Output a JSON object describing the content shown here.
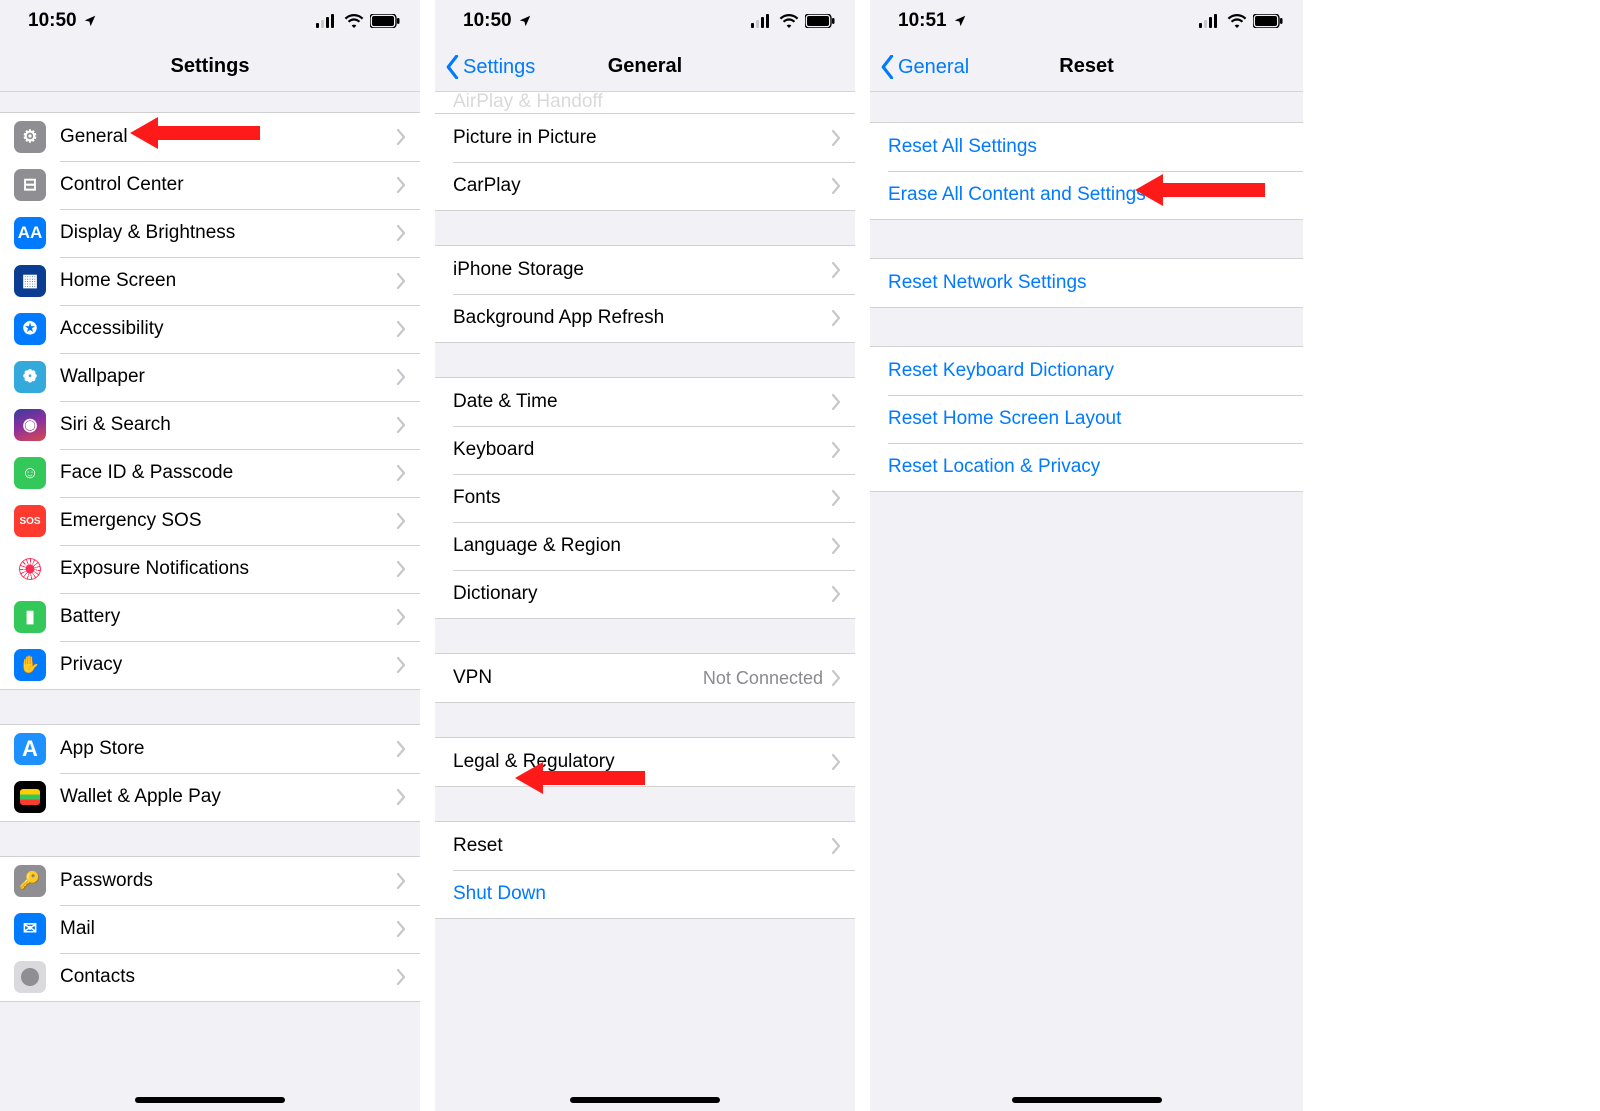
{
  "screens": {
    "settings": {
      "time": "10:50",
      "title": "Settings",
      "items_g1": [
        {
          "name": "general",
          "label": "General",
          "iconColor": "ic-gray",
          "glyph": "⚙"
        },
        {
          "name": "control-center",
          "label": "Control Center",
          "iconColor": "ic-gray",
          "glyph": "⊟"
        },
        {
          "name": "display-brightness",
          "label": "Display & Brightness",
          "iconColor": "ic-blue",
          "glyph": "AA"
        },
        {
          "name": "home-screen",
          "label": "Home Screen",
          "iconColor": "ic-darkblue",
          "glyph": "▦"
        },
        {
          "name": "accessibility",
          "label": "Accessibility",
          "iconColor": "ic-blue",
          "glyph": "✪"
        },
        {
          "name": "wallpaper",
          "label": "Wallpaper",
          "iconColor": "ic-teal",
          "glyph": "❁"
        },
        {
          "name": "siri-search",
          "label": "Siri & Search",
          "iconColor": "ic-indigo",
          "glyph": "◉"
        },
        {
          "name": "faceid-passcode",
          "label": "Face ID & Passcode",
          "iconColor": "ic-green",
          "glyph": "☺"
        },
        {
          "name": "emergency-sos",
          "label": "Emergency SOS",
          "iconColor": "ic-red",
          "glyph": "SOS"
        },
        {
          "name": "exposure-notifications",
          "label": "Exposure Notifications",
          "iconColor": "pink",
          "glyph": ""
        },
        {
          "name": "battery",
          "label": "Battery",
          "iconColor": "ic-green",
          "glyph": "▮"
        },
        {
          "name": "privacy",
          "label": "Privacy",
          "iconColor": "ic-blue",
          "glyph": "✋"
        }
      ],
      "items_g2": [
        {
          "name": "app-store",
          "label": "App Store",
          "iconColor": "appstore",
          "glyph": "A"
        },
        {
          "name": "wallet-apple-pay",
          "label": "Wallet & Apple Pay",
          "iconColor": "wallet",
          "glyph": ""
        }
      ],
      "items_g3": [
        {
          "name": "passwords",
          "label": "Passwords",
          "iconColor": "ic-gray",
          "glyph": "🔑"
        },
        {
          "name": "mail",
          "label": "Mail",
          "iconColor": "ic-blue",
          "glyph": "✉"
        },
        {
          "name": "contacts",
          "label": "Contacts",
          "iconColor": "contacts",
          "glyph": ""
        }
      ]
    },
    "general": {
      "time": "10:50",
      "back": "Settings",
      "title": "General",
      "clipped_top": "AirPlay & Handoff",
      "g1": [
        {
          "name": "picture-in-picture",
          "label": "Picture in Picture"
        },
        {
          "name": "carplay",
          "label": "CarPlay"
        }
      ],
      "g2": [
        {
          "name": "iphone-storage",
          "label": "iPhone Storage"
        },
        {
          "name": "background-app-refresh",
          "label": "Background App Refresh"
        }
      ],
      "g3": [
        {
          "name": "date-time",
          "label": "Date & Time"
        },
        {
          "name": "keyboard",
          "label": "Keyboard"
        },
        {
          "name": "fonts",
          "label": "Fonts"
        },
        {
          "name": "language-region",
          "label": "Language & Region"
        },
        {
          "name": "dictionary",
          "label": "Dictionary"
        }
      ],
      "g4": [
        {
          "name": "vpn",
          "label": "VPN",
          "detail": "Not Connected"
        }
      ],
      "g5": [
        {
          "name": "legal-regulatory",
          "label": "Legal & Regulatory"
        }
      ],
      "g6": [
        {
          "name": "reset",
          "label": "Reset"
        },
        {
          "name": "shut-down",
          "label": "Shut Down",
          "blue": true,
          "nochev": true
        }
      ]
    },
    "reset": {
      "time": "10:51",
      "back": "General",
      "title": "Reset",
      "g1": [
        {
          "name": "reset-all-settings",
          "label": "Reset All Settings"
        },
        {
          "name": "erase-all-content",
          "label": "Erase All Content and Settings"
        }
      ],
      "g2": [
        {
          "name": "reset-network-settings",
          "label": "Reset Network Settings"
        }
      ],
      "g3": [
        {
          "name": "reset-keyboard-dictionary",
          "label": "Reset Keyboard Dictionary"
        },
        {
          "name": "reset-home-screen-layout",
          "label": "Reset Home Screen Layout"
        },
        {
          "name": "reset-location-privacy",
          "label": "Reset Location & Privacy"
        }
      ]
    }
  }
}
